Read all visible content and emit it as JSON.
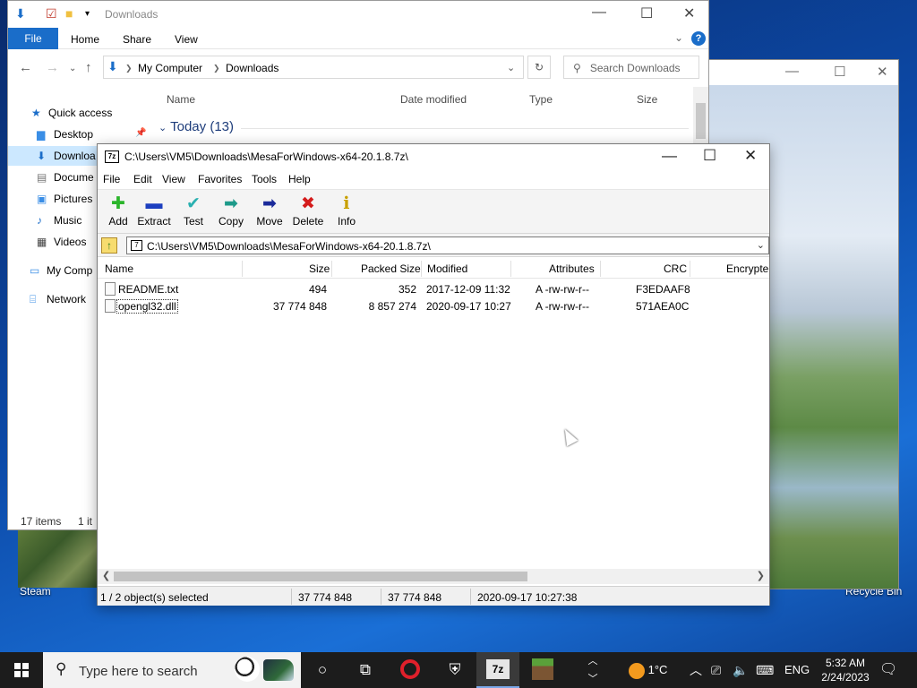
{
  "desktop": {
    "icons": [
      {
        "label": "Steam"
      },
      {
        "label": "Recycle Bin"
      }
    ]
  },
  "explorer": {
    "title": "Downloads",
    "ribbon_tabs": [
      "File",
      "Home",
      "Share",
      "View"
    ],
    "breadcrumb": [
      "My Computer",
      "Downloads"
    ],
    "search_placeholder": "Search Downloads",
    "columns": [
      "Name",
      "Date modified",
      "Type",
      "Size"
    ],
    "nav": [
      {
        "label": "Quick access"
      },
      {
        "label": "Desktop"
      },
      {
        "label": "Downloa"
      },
      {
        "label": "Docume"
      },
      {
        "label": "Pictures"
      },
      {
        "label": "Music"
      },
      {
        "label": "Videos"
      },
      {
        "label": "My Comp"
      },
      {
        "label": "Network"
      }
    ],
    "group_label": "Today (13)",
    "status_items": "17 items",
    "status_selected": "1 it"
  },
  "zip": {
    "title": "C:\\Users\\VM5\\Downloads\\MesaForWindows-x64-20.1.8.7z\\",
    "menu": [
      "File",
      "Edit",
      "View",
      "Favorites",
      "Tools",
      "Help"
    ],
    "toolbar": [
      {
        "label": "Add",
        "icon": "add-icon",
        "color": "#2bb52b"
      },
      {
        "label": "Extract",
        "icon": "extract-icon",
        "color": "#1d3fbf"
      },
      {
        "label": "Test",
        "icon": "test-icon",
        "color": "#2ab0b0"
      },
      {
        "label": "Copy",
        "icon": "copy-icon",
        "color": "#1d9a8a"
      },
      {
        "label": "Move",
        "icon": "move-icon",
        "color": "#1a2a9a"
      },
      {
        "label": "Delete",
        "icon": "delete-icon",
        "color": "#d41c1c"
      },
      {
        "label": "Info",
        "icon": "info-icon",
        "color": "#c8a000"
      }
    ],
    "path": "C:\\Users\\VM5\\Downloads\\MesaForWindows-x64-20.1.8.7z\\",
    "columns": [
      "Name",
      "Size",
      "Packed Size",
      "Modified",
      "Attributes",
      "CRC",
      "Encrypte"
    ],
    "rows": [
      {
        "name": "README.txt",
        "size": "494",
        "packed": "352",
        "modified": "2017-12-09 11:32",
        "attributes": "A -rw-rw-r--",
        "crc": "F3EDAAF8",
        "selected": false
      },
      {
        "name": "opengl32.dll",
        "size": "37 774 848",
        "packed": "8 857 274",
        "modified": "2020-09-17 10:27",
        "attributes": "A -rw-rw-r--",
        "crc": "571AEA0C",
        "selected": true
      }
    ],
    "status": {
      "selection": "1 / 2 object(s) selected",
      "size": "37 774 848",
      "packed": "37 774 848",
      "modified": "2020-09-17 10:27:38"
    }
  },
  "taskbar": {
    "search_placeholder": "Type here to search",
    "temperature": "1°C",
    "language": "ENG",
    "time": "5:32 AM",
    "date": "2/24/2023",
    "apps": [
      "Cortana",
      "Task View",
      "Opera",
      "Security",
      "7z",
      "Minecraft"
    ]
  }
}
